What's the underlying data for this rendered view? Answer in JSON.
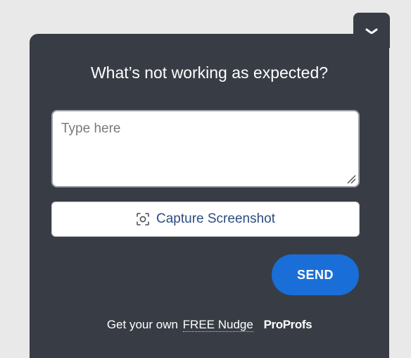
{
  "widget": {
    "title": "What’s not working as expected?",
    "feedback": {
      "value": "",
      "placeholder": "Type here"
    },
    "capture_label": "Capture Screenshot",
    "send_label": "SEND",
    "footer": {
      "prefix": "Get your own",
      "link_text": "FREE Nudge",
      "brand": "ProProfs"
    }
  },
  "icons": {
    "collapse": "chevron-down-icon",
    "capture": "screenshot-icon",
    "resize": "resize-grip-icon"
  },
  "colors": {
    "panel_bg": "#383d45",
    "page_bg": "#e9e9ea",
    "send_button": "#1a6ed8",
    "capture_text": "#2b4d80"
  }
}
